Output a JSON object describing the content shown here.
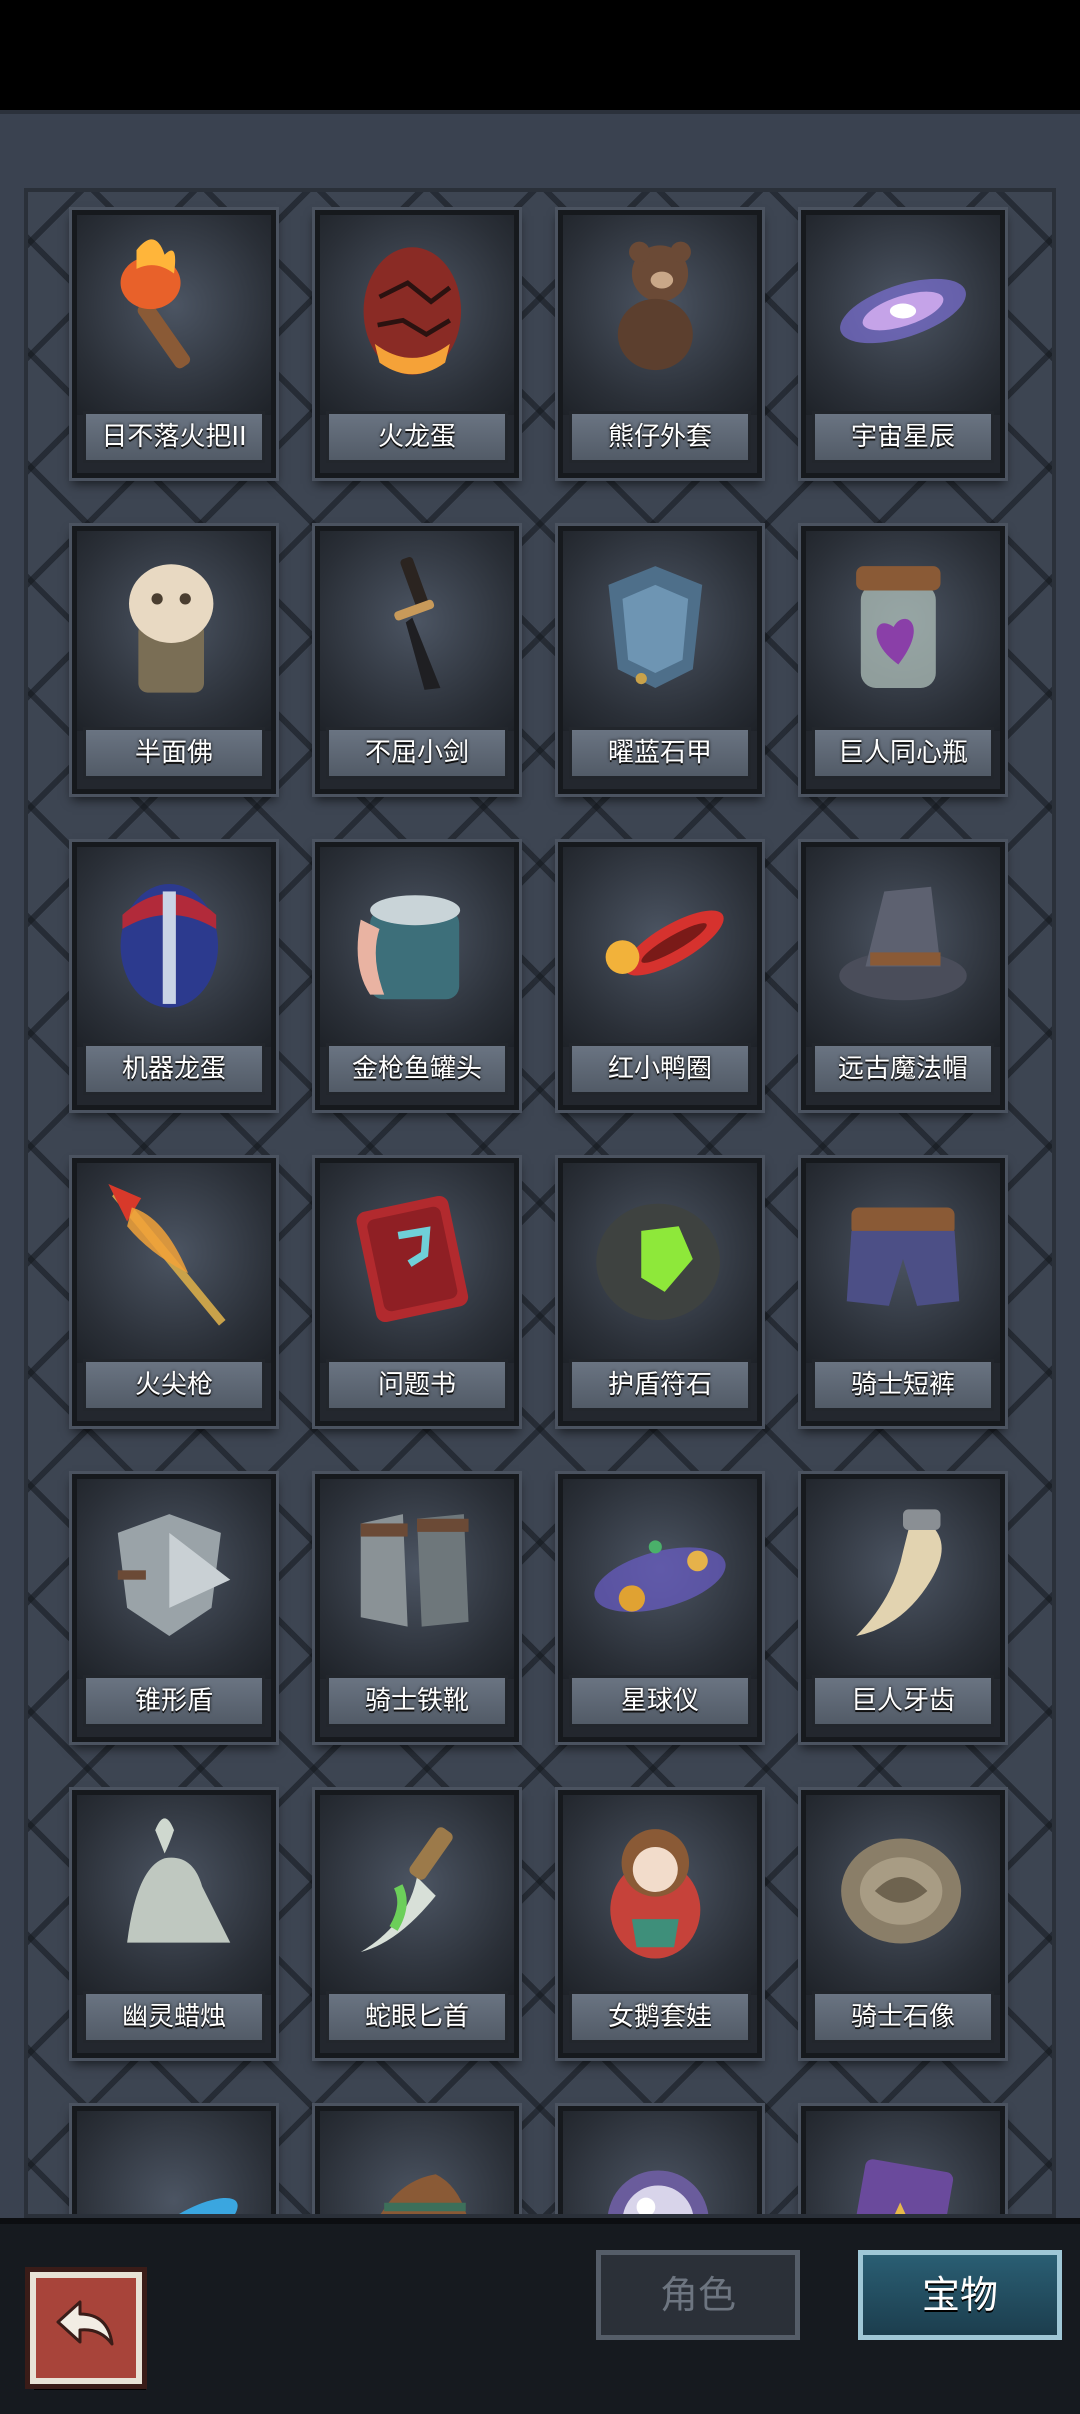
{
  "items": [
    {
      "name": "日不落火把II",
      "icon": "torch-icon"
    },
    {
      "name": "火龙蛋",
      "icon": "fire-egg-icon"
    },
    {
      "name": "熊仔外套",
      "icon": "teddy-bear-icon"
    },
    {
      "name": "宇宙星辰",
      "icon": "galaxy-icon"
    },
    {
      "name": "半面佛",
      "icon": "half-face-mask-icon"
    },
    {
      "name": "不屈小剑",
      "icon": "short-sword-icon"
    },
    {
      "name": "曜蓝石甲",
      "icon": "blue-armor-icon"
    },
    {
      "name": "巨人同心瓶",
      "icon": "heart-jar-icon"
    },
    {
      "name": "机器龙蛋",
      "icon": "robot-egg-icon"
    },
    {
      "name": "金枪鱼罐头",
      "icon": "tuna-can-icon"
    },
    {
      "name": "红小鸭圈",
      "icon": "duck-ring-icon"
    },
    {
      "name": "远古魔法帽",
      "icon": "wizard-hat-icon"
    },
    {
      "name": "火尖枪",
      "icon": "fire-spear-icon"
    },
    {
      "name": "问题书",
      "icon": "question-book-icon"
    },
    {
      "name": "护盾符石",
      "icon": "rune-stone-icon"
    },
    {
      "name": "骑士短裤",
      "icon": "knight-shorts-icon"
    },
    {
      "name": "锥形盾",
      "icon": "spike-shield-icon"
    },
    {
      "name": "骑士铁靴",
      "icon": "iron-boots-icon"
    },
    {
      "name": "星球仪",
      "icon": "orrery-icon"
    },
    {
      "name": "巨人牙齿",
      "icon": "giant-tooth-icon"
    },
    {
      "name": "幽灵蜡烛",
      "icon": "ghost-candle-icon"
    },
    {
      "name": "蛇眼匕首",
      "icon": "dagger-icon"
    },
    {
      "name": "女鹅套娃",
      "icon": "nesting-doll-icon"
    },
    {
      "name": "骑士石像",
      "icon": "stone-plate-icon"
    },
    {
      "name": "",
      "icon": "blue-ring-icon"
    },
    {
      "name": "",
      "icon": "knit-hat-icon"
    },
    {
      "name": "",
      "icon": "crystal-ball-icon"
    },
    {
      "name": "",
      "icon": "purple-book-icon"
    }
  ],
  "tabs": {
    "role": "角色",
    "treasure": "宝物",
    "active": "treasure"
  },
  "back_icon": "back-arrow-icon",
  "colors": {
    "panel": "#3a4250",
    "card": "#23272e",
    "label": "#5f6875",
    "back_button": "#a8443a",
    "active_tab": "#2a5e73"
  }
}
